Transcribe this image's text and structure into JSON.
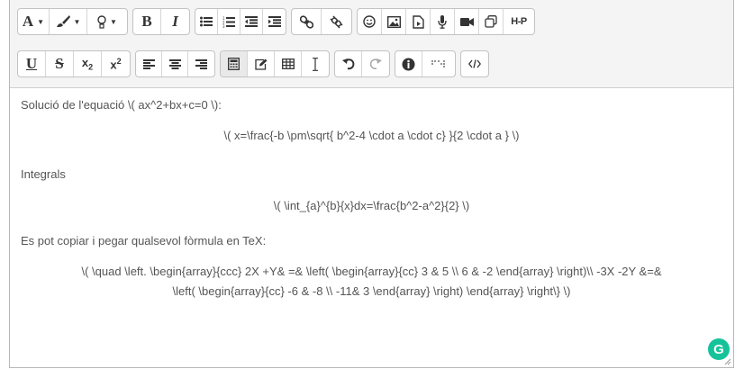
{
  "toolbar": {
    "row1": {
      "font": "A",
      "bold": "B",
      "italic": "I",
      "h5p": "H-P"
    },
    "row2": {
      "underline": "U",
      "strike": "S",
      "subscript_base": "x",
      "subscript_sub": "2",
      "superscript_base": "x",
      "superscript_sup": "2"
    }
  },
  "content": {
    "line1": "Solució de l'equació \\( ax^2+bx+c=0 \\):",
    "line2": "\\( x=\\frac{-b \\pm\\sqrt{ b^2-4 \\cdot a \\cdot c} }{2 \\cdot a } \\)",
    "line3": "Integrals",
    "line4": "\\( \\int_{a}^{b}{x}dx=\\frac{b^2-a^2}{2} \\)",
    "line5": "Es pot copiar i pegar qualsevol fòrmula en TeX:",
    "line6a": "\\( \\quad \\left. \\begin{array}{ccc} 2X +Y& =& \\left( \\begin{array}{cc} 3 & 5 \\\\ 6 & -2 \\end{array} \\right)\\\\ -3X -2Y &=&",
    "line6b": "\\left( \\begin{array}{cc} -6 & -8 \\\\ -11& 3 \\end{array} \\right) \\end{array} \\right\\} \\)"
  },
  "grammarly": "G"
}
